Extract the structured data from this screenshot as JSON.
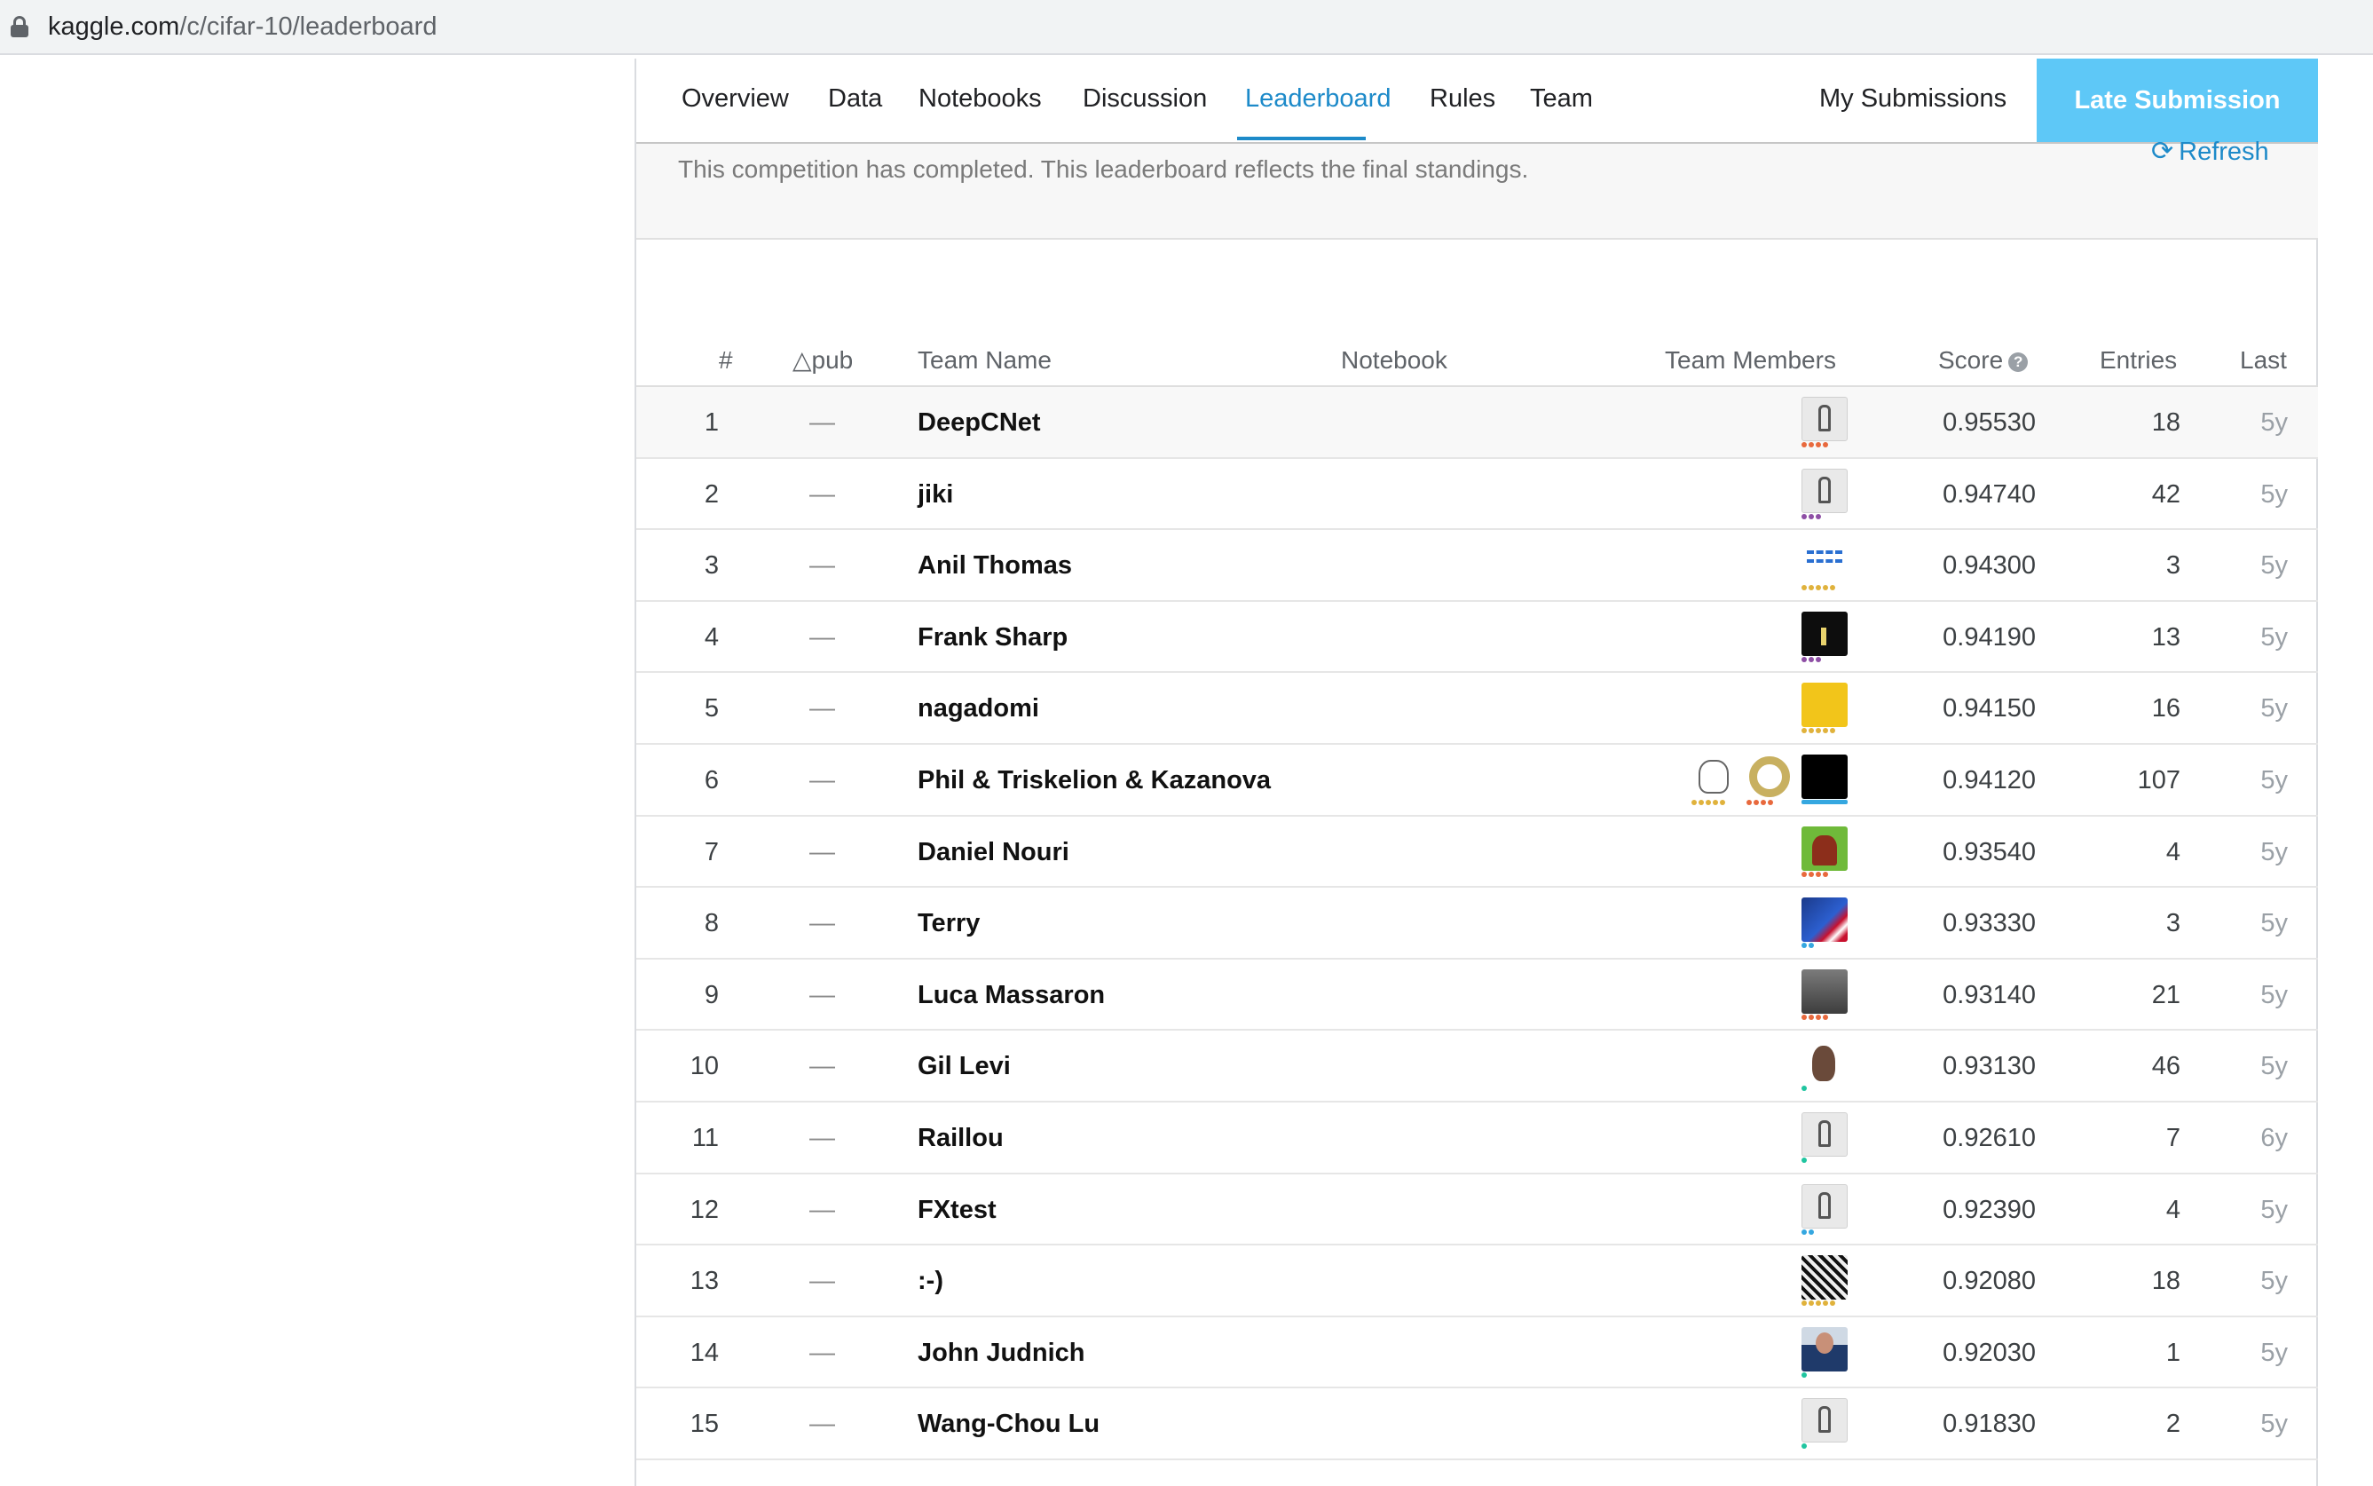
{
  "browser": {
    "url_domain": "kaggle.com",
    "url_path": "/c/cifar-10/leaderboard"
  },
  "tabs": [
    {
      "label": "Overview"
    },
    {
      "label": "Data"
    },
    {
      "label": "Notebooks"
    },
    {
      "label": "Discussion"
    },
    {
      "label": "Leaderboard",
      "active": true
    },
    {
      "label": "Rules"
    },
    {
      "label": "Team"
    }
  ],
  "my_submissions_label": "My Submissions",
  "late_submission_label": "Late Submission",
  "notice": "This competition has completed. This leaderboard reflects the final standings.",
  "refresh_label": "Refresh",
  "refresh_icon": "refresh-icon",
  "columns": {
    "rank": "#",
    "delta": "△pub",
    "team": "Team Name",
    "notebook": "Notebook",
    "members": "Team Members",
    "score": "Score",
    "entries": "Entries",
    "last": "Last"
  },
  "score_help_icon": "question-circle-icon",
  "colors": {
    "accent": "#1d8ac9",
    "late_button": "#5ec8f7",
    "tier_orange": "#e8693d",
    "tier_purple": "#8e4fa5",
    "tier_gold": "#e0b23c",
    "tier_blue": "#35a7e0",
    "tier_teal": "#20c5a0"
  },
  "rows": [
    {
      "rank": "1",
      "delta": "—",
      "team": "DeepCNet",
      "score": "0.95530",
      "entries": "18",
      "last": "5y",
      "members": [
        {
          "avatar": "default-avatar",
          "tier": "orange",
          "tier_count": 4
        }
      ]
    },
    {
      "rank": "2",
      "delta": "—",
      "team": "jiki",
      "score": "0.94740",
      "entries": "42",
      "last": "5y",
      "members": [
        {
          "avatar": "default-avatar",
          "tier": "purple",
          "tier_count": 3
        }
      ]
    },
    {
      "rank": "3",
      "delta": "—",
      "team": "Anil Thomas",
      "score": "0.94300",
      "entries": "3",
      "last": "5y",
      "members": [
        {
          "avatar": "pixel-avatar",
          "tier": "gold",
          "tier_count": 5
        }
      ]
    },
    {
      "rank": "4",
      "delta": "—",
      "team": "Frank Sharp",
      "score": "0.94190",
      "entries": "13",
      "last": "5y",
      "members": [
        {
          "avatar": "night-photo-avatar",
          "tier": "purple",
          "tier_count": 3
        }
      ]
    },
    {
      "rank": "5",
      "delta": "—",
      "team": "nagadomi",
      "score": "0.94150",
      "entries": "16",
      "last": "5y",
      "members": [
        {
          "avatar": "honeycomb-avatar",
          "tier": "gold",
          "tier_count": 5
        }
      ]
    },
    {
      "rank": "6",
      "delta": "—",
      "team": "Phil & Triskelion & Kazanova",
      "score": "0.94120",
      "entries": "107",
      "last": "5y",
      "members": [
        {
          "avatar": "sketch-avatar",
          "tier": "gold",
          "tier_count": 5
        },
        {
          "avatar": "triskelion-avatar",
          "tier": "orange",
          "tier_count": 4
        },
        {
          "avatar": "black-avatar",
          "tier": "blue-bar",
          "tier_count": 1
        }
      ]
    },
    {
      "rank": "7",
      "delta": "—",
      "team": "Daniel Nouri",
      "score": "0.93540",
      "entries": "4",
      "last": "5y",
      "members": [
        {
          "avatar": "green-avatar",
          "tier": "orange",
          "tier_count": 4
        }
      ]
    },
    {
      "rank": "8",
      "delta": "—",
      "team": "Terry",
      "score": "0.93330",
      "entries": "3",
      "last": "5y",
      "members": [
        {
          "avatar": "flag-avatar",
          "tier": "blue",
          "tier_count": 2
        }
      ]
    },
    {
      "rank": "9",
      "delta": "—",
      "team": "Luca Massaron",
      "score": "0.93140",
      "entries": "21",
      "last": "5y",
      "members": [
        {
          "avatar": "photo-avatar",
          "tier": "orange",
          "tier_count": 4
        }
      ]
    },
    {
      "rank": "10",
      "delta": "—",
      "team": "Gil Levi",
      "score": "0.93130",
      "entries": "46",
      "last": "5y",
      "members": [
        {
          "avatar": "face-avatar",
          "tier": "teal",
          "tier_count": 1
        }
      ]
    },
    {
      "rank": "11",
      "delta": "—",
      "team": "Raillou",
      "score": "0.92610",
      "entries": "7",
      "last": "6y",
      "members": [
        {
          "avatar": "default-avatar",
          "tier": "teal",
          "tier_count": 1
        }
      ]
    },
    {
      "rank": "12",
      "delta": "—",
      "team": "FXtest",
      "score": "0.92390",
      "entries": "4",
      "last": "5y",
      "members": [
        {
          "avatar": "default-avatar",
          "tier": "blue",
          "tier_count": 2
        }
      ]
    },
    {
      "rank": "13",
      "delta": "—",
      "team": ":-)",
      "score": "0.92080",
      "entries": "18",
      "last": "5y",
      "members": [
        {
          "avatar": "manga-avatar",
          "tier": "gold",
          "tier_count": 5
        }
      ]
    },
    {
      "rank": "14",
      "delta": "—",
      "team": "John Judnich",
      "score": "0.92030",
      "entries": "1",
      "last": "5y",
      "members": [
        {
          "avatar": "man-avatar",
          "tier": "teal",
          "tier_count": 1
        }
      ]
    },
    {
      "rank": "15",
      "delta": "—",
      "team": "Wang-Chou Lu",
      "score": "0.91830",
      "entries": "2",
      "last": "5y",
      "members": [
        {
          "avatar": "default-avatar",
          "tier": "teal",
          "tier_count": 1
        }
      ]
    }
  ]
}
